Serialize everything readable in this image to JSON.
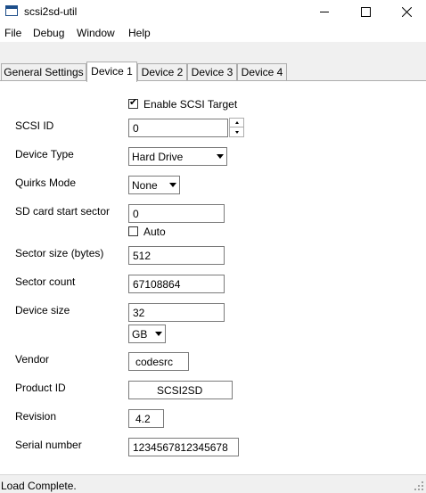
{
  "window": {
    "title": "scsi2sd-util",
    "icon": "app-icon"
  },
  "menu": [
    "File",
    "Debug",
    "Window",
    "Help"
  ],
  "tabs": [
    {
      "label": "General Settings",
      "active": false
    },
    {
      "label": "Device 1",
      "active": true
    },
    {
      "label": "Device 2",
      "active": false
    },
    {
      "label": "Device 3",
      "active": false
    },
    {
      "label": "Device 4",
      "active": false
    }
  ],
  "form": {
    "enable_target": {
      "label": "Enable SCSI Target",
      "checked": true
    },
    "scsi_id": {
      "label": "SCSI ID",
      "value": "0"
    },
    "device_type": {
      "label": "Device Type",
      "value": "Hard Drive"
    },
    "quirks_mode": {
      "label": "Quirks Mode",
      "value": "None"
    },
    "start_sector": {
      "label": "SD card start sector",
      "value": "0"
    },
    "auto": {
      "label": "Auto",
      "checked": false
    },
    "sector_size": {
      "label": "Sector size (bytes)",
      "value": "512"
    },
    "sector_count": {
      "label": "Sector count",
      "value": "67108864"
    },
    "device_size": {
      "label": "Device size",
      "value": "32",
      "unit": "GB"
    },
    "vendor": {
      "label": "Vendor",
      "value": "codesrc"
    },
    "product_id": {
      "label": "Product ID",
      "value": "SCSI2SD"
    },
    "revision": {
      "label": "Revision",
      "value": "4.2"
    },
    "serial": {
      "label": "Serial number",
      "value": "1234567812345678"
    }
  },
  "status": "Load Complete."
}
